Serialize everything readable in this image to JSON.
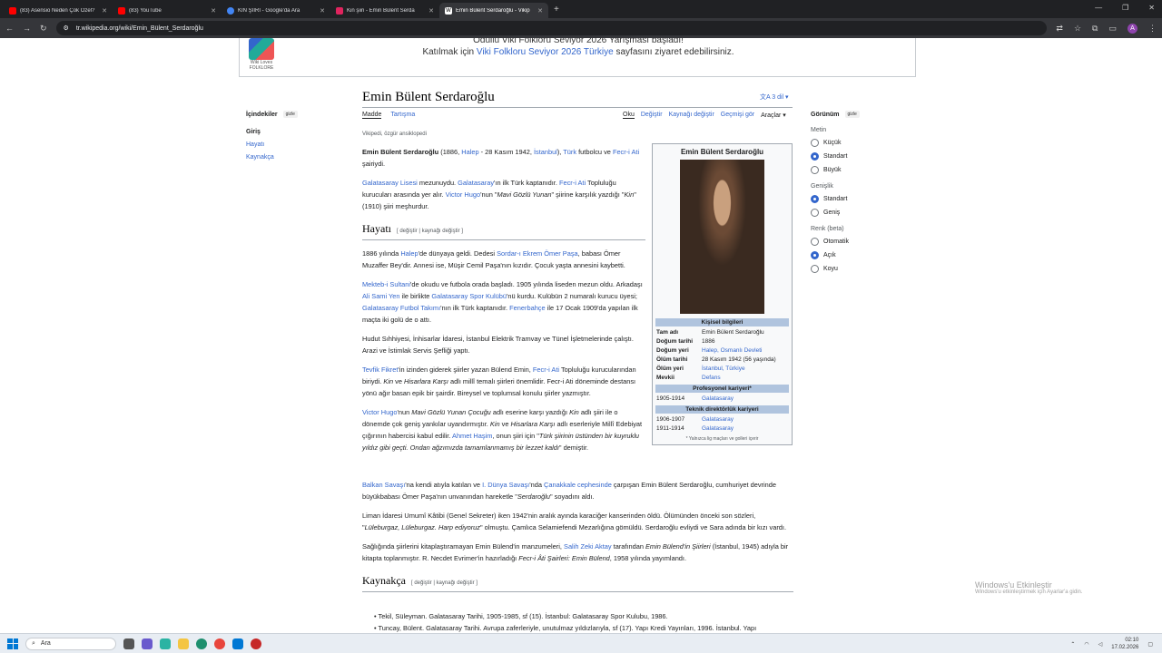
{
  "browser": {
    "tabs": [
      {
        "title": "(83) Asensio Neden Çok Özel?",
        "color": "#ff0000"
      },
      {
        "title": "(83) YouTube",
        "color": "#ff0000"
      },
      {
        "title": "KIN ŞİİRİ - Google'da Ara",
        "color": "#4285f4"
      },
      {
        "title": "Kin şiiri - Emin Bülent Serda",
        "color": "#e0245e"
      },
      {
        "title": "Emin Bülent Serdaroğlu - Vikip",
        "color": "#ffffff"
      }
    ],
    "url": "tr.wikipedia.org/wiki/Emin_Bülent_Serdaroğlu",
    "profile": "A"
  },
  "banner": {
    "line1": "Ödüllü Viki Folkloru Seviyor 2026 Yarışması başladı!",
    "line2_pre": "Katılmak için ",
    "line2_link": "Viki Folkloru Seviyor 2026 Türkiye",
    "line2_post": " sayfasını ziyaret edebilirsiniz.",
    "logo": "Wiki Loves FOLKLORE"
  },
  "page": {
    "title": "Emin Bülent Serdaroğlu",
    "lang": "3 dil",
    "tabs_left": [
      "Madde",
      "Tartışma"
    ],
    "tabs_right": [
      "Oku",
      "Değiştir",
      "Kaynağı değiştir",
      "Geçmişi gör",
      "Araçlar"
    ],
    "tagline": "Vikipedi, özgür ansiklopedi"
  },
  "toc": {
    "title": "İçindekiler",
    "hide": "gizle",
    "items": [
      "Giriş",
      "Hayatı",
      "Kaynakça"
    ]
  },
  "appearance": {
    "title": "Görünüm",
    "hide": "gizle",
    "groups": [
      {
        "label": "Metin",
        "options": [
          "Küçük",
          "Standart",
          "Büyük"
        ],
        "selected": 1
      },
      {
        "label": "Genişlik",
        "options": [
          "Standart",
          "Geniş"
        ],
        "selected": 0
      },
      {
        "label": "Renk (beta)",
        "options": [
          "Otomatik",
          "Açık",
          "Koyu"
        ],
        "selected": 1
      }
    ]
  },
  "sections": {
    "hayati": "Hayatı",
    "kaynakca": "Kaynakça",
    "edit": "[ değiştir | kaynağı değiştir ]"
  },
  "infobox": {
    "title": "Emin Bülent Serdaroğlu",
    "personal": "Kişisel bilgileri",
    "rows": [
      [
        "Tam adı",
        "Emin Bülent Serdaroğlu"
      ],
      [
        "Doğum tarihi",
        "1886"
      ],
      [
        "Doğum yeri",
        "Halep, Osmanlı Devleti"
      ],
      [
        "Ölüm tarihi",
        "28 Kasım 1942 (56 yaşında)"
      ],
      [
        "Ölüm yeri",
        "İstanbul, Türkiye"
      ],
      [
        "Mevkii",
        "Defans"
      ]
    ],
    "career": "Profesyonel kariyeri*",
    "career_rows": [
      [
        "1905-1914",
        "Galatasaray"
      ]
    ],
    "coach": "Teknik direktörlük kariyeri",
    "coach_rows": [
      [
        "1906-1907",
        "Galatasaray"
      ],
      [
        "1911-1914",
        "Galatasaray"
      ]
    ],
    "note": "* Yalnızca lig maçları ve golleri içerir"
  },
  "refs": [
    "Tekil, Süleyman. Galatasaray Tarihi, 1905-1985, sf (15). İstanbul: Galatasaray Spor Kulubu, 1986.",
    "Tuncay, Bülent. Galatasaray Tarihi. Avrupa zaferleriyle, unutulmaz yıldızlarıyla, sf (17). Yapı Kredi Yayınları, 1996. İstanbul. Yapı"
  ],
  "watermark": {
    "l1": "Windows'u Etkinleştir",
    "l2": "Windows'u etkinleştirmek için Ayarlar'a gidin."
  },
  "taskbar": {
    "search": "Ara",
    "time": "02:10",
    "date": "17.02.2026"
  }
}
